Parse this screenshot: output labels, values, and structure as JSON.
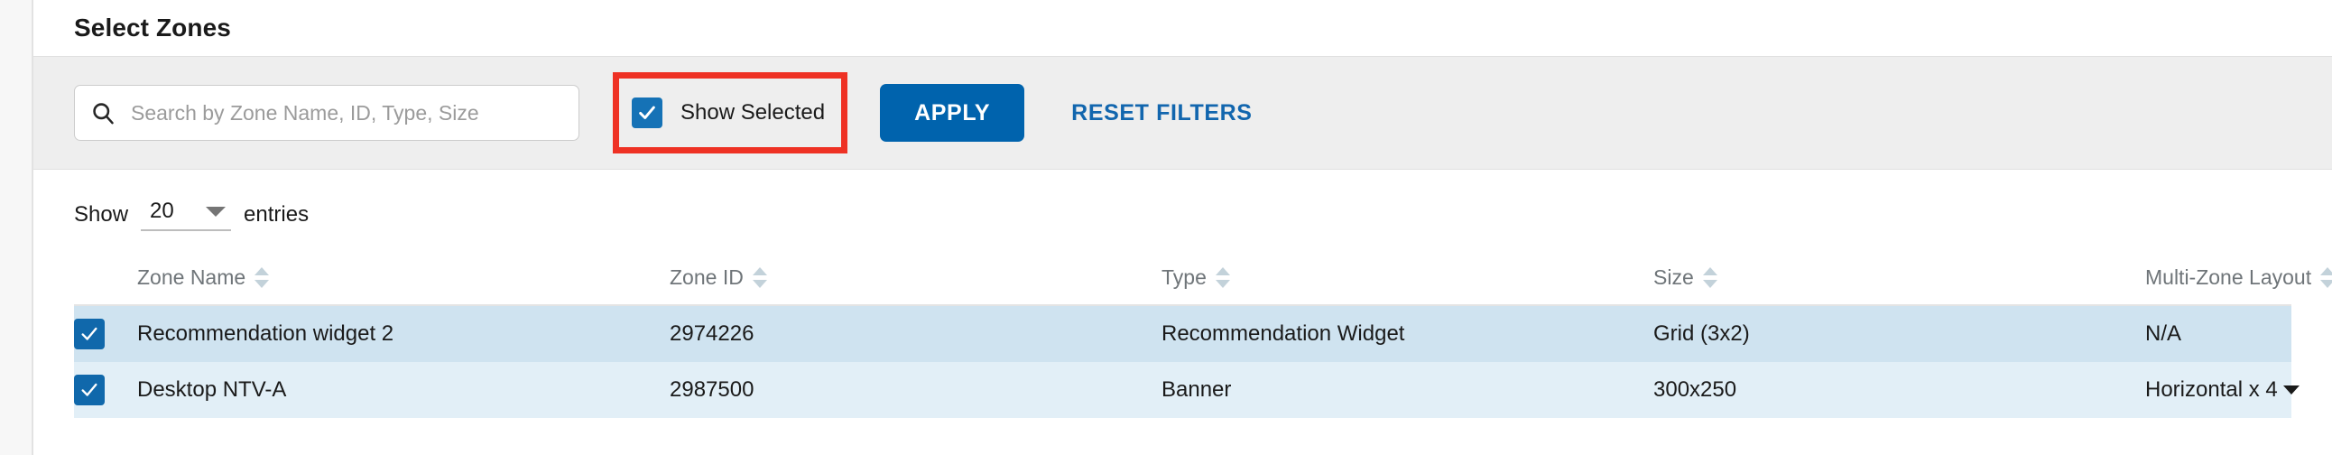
{
  "header": {
    "title": "Select Zones"
  },
  "filters": {
    "search": {
      "placeholder": "Search by Zone Name, ID, Type, Size",
      "value": "",
      "icon": "search-icon"
    },
    "show_selected": {
      "label": "Show Selected",
      "checked": true,
      "highlight_color": "#ee3124"
    },
    "apply_label": "APPLY",
    "reset_label": "RESET FILTERS",
    "accent_color": "#0063ad",
    "link_color": "#1266ae"
  },
  "pagination": {
    "show_label": "Show",
    "entries_value": "20",
    "entries_label": "entries",
    "caret_icon": "chevron-down-icon"
  },
  "table": {
    "columns": [
      {
        "label": "Zone Name",
        "sortable": true
      },
      {
        "label": "Zone ID",
        "sortable": true
      },
      {
        "label": "Type",
        "sortable": true
      },
      {
        "label": "Size",
        "sortable": true
      },
      {
        "label": "Multi-Zone Layout",
        "sortable": true
      }
    ],
    "rows": [
      {
        "selected": true,
        "zone_name": "Recommendation widget 2",
        "zone_id": "2974226",
        "type": "Recommendation Widget",
        "size": "Grid (3x2)",
        "multi_zone_layout": "N/A",
        "layout_has_dropdown": false,
        "row_bg": "#cfe3f0"
      },
      {
        "selected": true,
        "zone_name": "Desktop NTV-A",
        "zone_id": "2987500",
        "type": "Banner",
        "size": "300x250",
        "multi_zone_layout": "Horizontal x 4",
        "layout_has_dropdown": true,
        "row_bg": "#e2eff7"
      }
    ]
  }
}
